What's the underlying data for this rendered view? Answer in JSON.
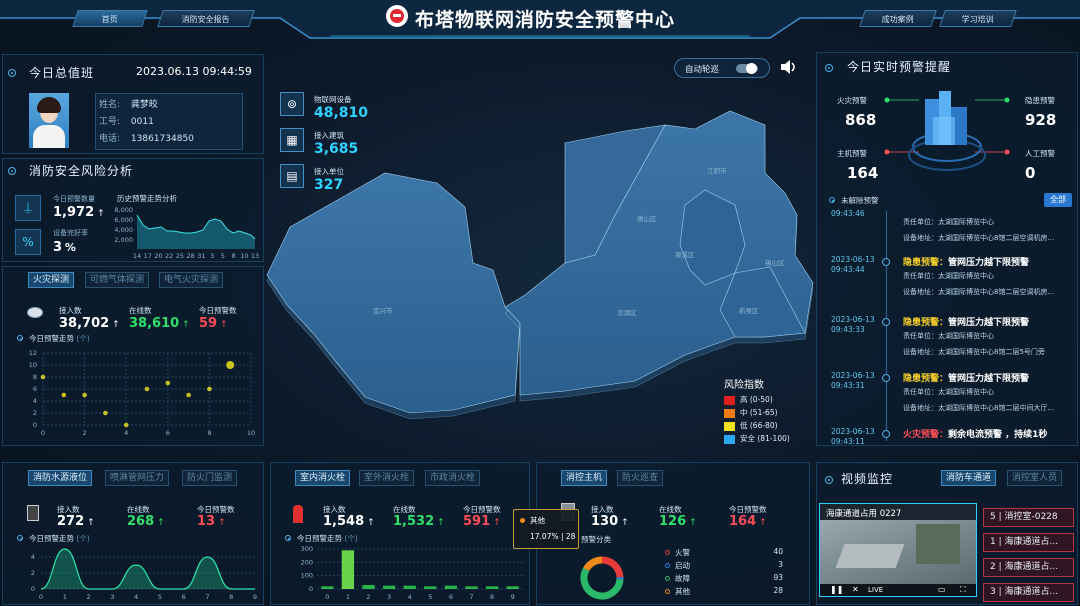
{
  "header": {
    "title": "布塔物联网消防安全预警中心",
    "nav_left": [
      "首页",
      "消防安全报告"
    ],
    "nav_right": [
      "成功案例",
      "学习培训"
    ]
  },
  "duty": {
    "title": "今日总值班",
    "datetime": "2023.06.13 09:44:59",
    "name_label": "姓名:",
    "name": "龚梦皎",
    "id_label": "工号:",
    "id": "0011",
    "phone_label": "电话:",
    "phone": "13861734850"
  },
  "risk": {
    "title": "消防安全风险分析",
    "warnings_label": "今日预警数量",
    "warnings": "1,972",
    "intact_label": "设备完好率",
    "intact": "3",
    "intact_unit": "%",
    "history_title": "历史预警走势分析",
    "history_y": [
      "2,000",
      "4,000",
      "6,000",
      "8,000"
    ],
    "history_x": [
      "14",
      "17",
      "20",
      "22",
      "25",
      "28",
      "31",
      "3",
      "5",
      "8",
      "10",
      "13"
    ]
  },
  "fire_detect": {
    "tabs": [
      "火灾探测",
      "可燃气体探测",
      "电气火灾探测"
    ],
    "access_label": "接入数",
    "access": "38,702",
    "online_label": "在线数",
    "online": "38,610",
    "warn_label": "今日预警数",
    "warn": "59",
    "trend_label": "今日预警走势",
    "trend_unit": "(个)",
    "chart_data": {
      "type": "scatter",
      "x": [
        0,
        1,
        2,
        3,
        4,
        5,
        6,
        7,
        8,
        9
      ],
      "y": [
        8,
        5,
        5,
        2,
        0,
        6,
        7,
        5,
        6,
        10
      ],
      "xlim": [
        0,
        10
      ],
      "ylim": [
        0,
        12
      ],
      "xticks": [
        "0",
        "2",
        "4",
        "6",
        "8",
        "10"
      ],
      "yticks": [
        "0",
        "2",
        "4",
        "6",
        "8",
        "10",
        "12"
      ]
    }
  },
  "map": {
    "devices_label": "物联网设备",
    "devices": "48,810",
    "buildings_label": "接入建筑",
    "buildings": "3,685",
    "units_label": "接入单位",
    "units": "327",
    "auto_patrol": "自动轮巡",
    "districts": [
      "江阴市",
      "惠山区",
      "梁溪区",
      "锡山区",
      "宜兴市",
      "滨湖区",
      "新吴区"
    ],
    "legend_title": "风险指数",
    "legend": [
      {
        "label": "高 (0-50)",
        "color": "#e02020"
      },
      {
        "label": "中 (51-65)",
        "color": "#f07a10"
      },
      {
        "label": "低 (66-80)",
        "color": "#f0e020"
      },
      {
        "label": "安全 (81-100)",
        "color": "#2aa8f0"
      }
    ]
  },
  "realtime": {
    "title": "今日实时预警提醒",
    "fire_label": "火灾预警",
    "fire": "868",
    "hidden_label": "隐患预警",
    "hidden": "928",
    "host_label": "主机预警",
    "host": "164",
    "manual_label": "人工预警",
    "manual": "0",
    "unresolved": "未解除预警",
    "all_btn": "全部",
    "first_time": "09:43:46",
    "first_unit": "责任单位：太湖国际博览中心",
    "first_addr": "设备地址：太湖国际博览中心8馆二层空调机房...",
    "alerts": [
      {
        "date": "2023-06-13",
        "time": "09:43:44",
        "type": "隐患预警：",
        "text": "管网压力越下限预警",
        "unit": "责任单位：太湖国际博览中心",
        "addr": "设备地址：太湖国际博览中心8馆二层空调机房..."
      },
      {
        "date": "2023-06-13",
        "time": "09:43:33",
        "type": "隐患预警：",
        "text": "管网压力越下限预警",
        "unit": "责任单位：太湖国际博览中心",
        "addr": "设备地址：太湖国际博览中心8馆二层5号门旁"
      },
      {
        "date": "2023-06-13",
        "time": "09:43:31",
        "type": "隐患预警：",
        "text": "管网压力越下限预警",
        "unit": "责任单位：太湖国际博览中心",
        "addr": "设备地址：太湖国际博览中心8馆二层中间大厅..."
      },
      {
        "date": "2023-06-13",
        "time": "09:43:11",
        "type": "火灾预警：",
        "text": "剩余电流预警 ，持续1秒",
        "unit": "",
        "addr": ""
      }
    ]
  },
  "water": {
    "tabs": [
      "消防水源液位",
      "喷淋管网压力",
      "防火门监测"
    ],
    "access": "272",
    "online": "268",
    "warn": "13",
    "access_label": "接入数",
    "online_label": "在线数",
    "warn_label": "今日预警数",
    "trend_label": "今日预警走势",
    "trend_unit": "(个)",
    "chart_data": {
      "type": "area",
      "x": [
        0,
        1,
        2,
        3,
        4,
        5,
        6,
        7,
        8,
        9
      ],
      "y": [
        0,
        5,
        0,
        0,
        3,
        0,
        0,
        4,
        0,
        0
      ],
      "ylim": [
        0,
        5
      ],
      "yticks": [
        "0",
        "2",
        "4"
      ],
      "xticks": [
        "0",
        "1",
        "2",
        "3",
        "4",
        "5",
        "6",
        "7",
        "8",
        "9"
      ]
    }
  },
  "hydrant": {
    "tabs": [
      "室内消火栓",
      "室外消火栓",
      "市政消火栓"
    ],
    "access": "1,548",
    "online": "1,532",
    "warn": "591",
    "access_label": "接入数",
    "online_label": "在线数",
    "warn_label": "今日预警数",
    "trend_label": "今日预警走势",
    "trend_unit": "(个)",
    "chart_data": {
      "type": "bar",
      "categories": [
        "0",
        "1",
        "2",
        "3",
        "4",
        "5",
        "6",
        "7",
        "8",
        "9"
      ],
      "values": [
        20,
        290,
        30,
        25,
        25,
        20,
        25,
        20,
        20,
        20
      ],
      "ylim": [
        0,
        300
      ],
      "yticks": [
        "0",
        "100",
        "200",
        "300"
      ]
    }
  },
  "host": {
    "tabs": [
      "消控主机",
      "防火巡查"
    ],
    "access": "130",
    "online": "126",
    "warn": "164",
    "access_label": "接入数",
    "online_label": "在线数",
    "warn_label": "今日预警数",
    "cat_label": "预警分类",
    "tooltip_name": "其他",
    "tooltip_value": "17.07%",
    "tooltip_count": "28",
    "chart_data": {
      "type": "pie",
      "labels": [
        "火警",
        "启动",
        "故障",
        "其他"
      ],
      "values": [
        40,
        3,
        93,
        28
      ],
      "colors": [
        "#e53b3b",
        "#2f7fe0",
        "#2ab86a",
        "#f08a1a"
      ]
    }
  },
  "video": {
    "title": "视频监控",
    "tabs": [
      "消防车通道",
      "消控室人员"
    ],
    "caption": "海康通道占用 0227",
    "live": "LIVE",
    "list": [
      "5 | 消控室-0228",
      "1 | 海康通道占...",
      "2 | 海康通道占...",
      "3 | 海康通道占..."
    ]
  }
}
